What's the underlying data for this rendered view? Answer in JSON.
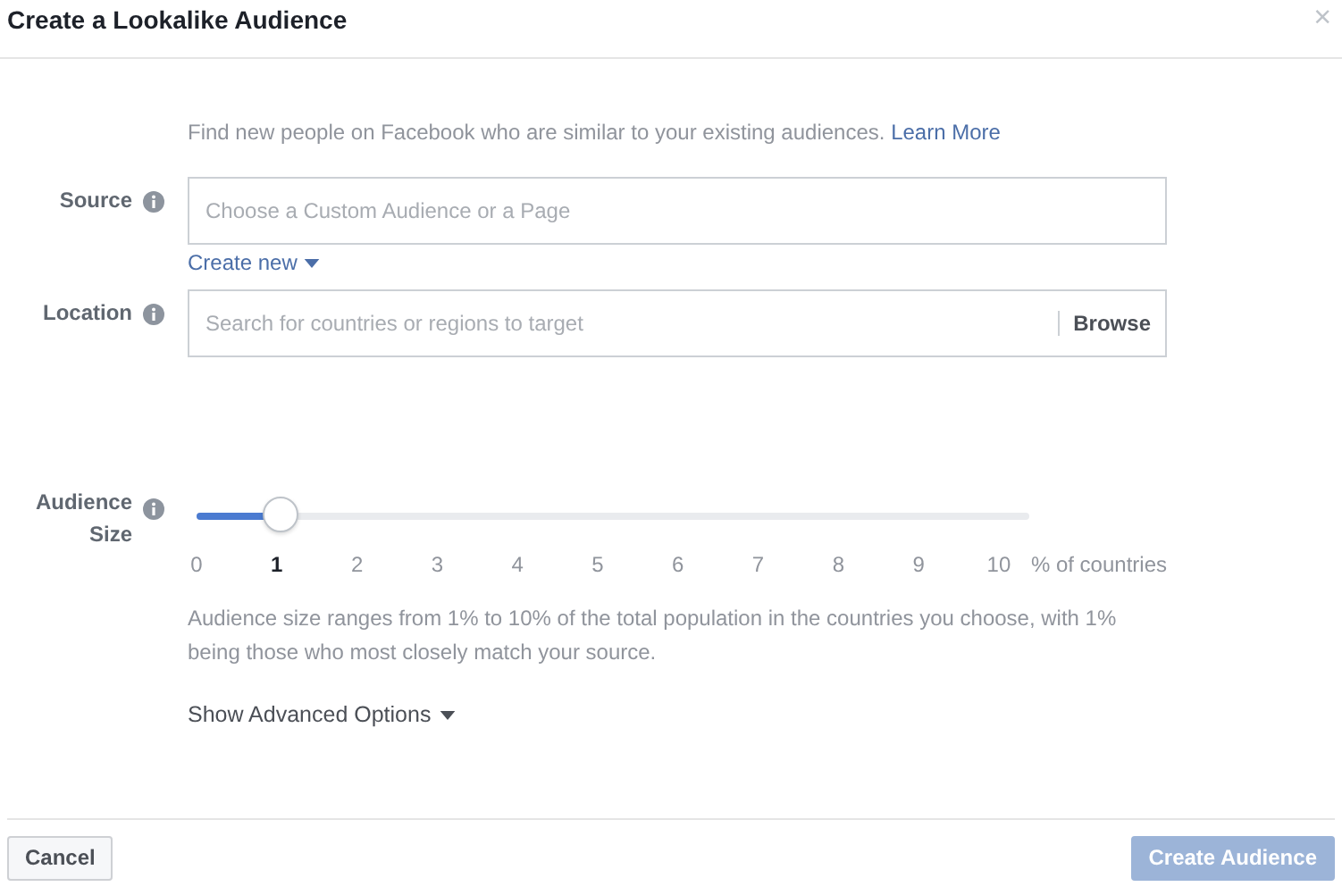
{
  "window": {
    "title": "Create a Lookalike Audience",
    "close": "×"
  },
  "intro": {
    "text": "Find new people on Facebook who are similar to your existing audiences.",
    "link": "Learn More"
  },
  "source": {
    "label": "Source",
    "placeholder": "Choose a Custom Audience or a Page",
    "create_new": "Create new"
  },
  "location": {
    "label": "Location",
    "placeholder": "Search for countries or regions to target",
    "browse": "Browse"
  },
  "audience_size": {
    "label_lines": [
      "Audience",
      "Size"
    ],
    "level": 0.1,
    "ticks": [
      {
        "label": "0",
        "selected": false
      },
      {
        "label": "1",
        "selected": true
      },
      {
        "label": "2",
        "selected": false
      },
      {
        "label": "3",
        "selected": false
      },
      {
        "label": "4",
        "selected": false
      },
      {
        "label": "5",
        "selected": false
      },
      {
        "label": "6",
        "selected": false
      },
      {
        "label": "7",
        "selected": false
      },
      {
        "label": "8",
        "selected": false
      },
      {
        "label": "9",
        "selected": false
      },
      {
        "label": "10",
        "selected": false
      }
    ],
    "unit": "% of countries",
    "description": "Audience size ranges from 1% to 10% of the total population in the countries you choose, with 1% being those who most closely match your source."
  },
  "advanced": "Show Advanced Options",
  "buttons": [
    {
      "label": "Cancel",
      "kind": "secondary",
      "disabled": false
    },
    {
      "label": "Create Audience",
      "kind": "primary",
      "disabled": true
    }
  ]
}
